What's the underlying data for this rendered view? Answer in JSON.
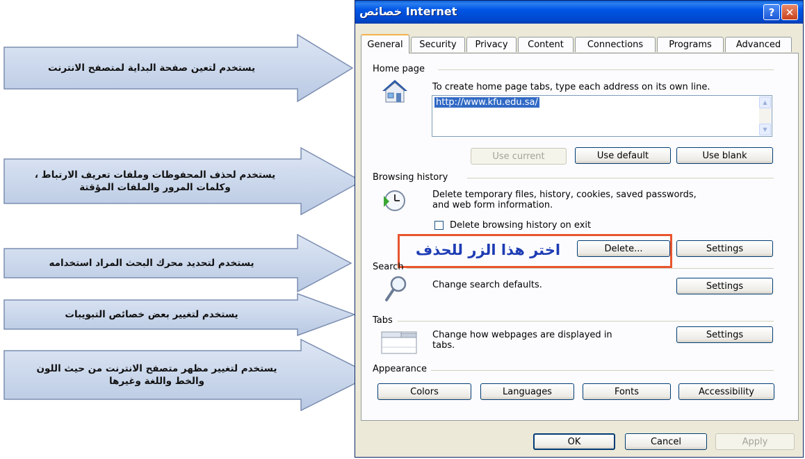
{
  "callouts": [
    {
      "text": "يستخدم لتعين صفحة البداية لمتصفح الانترنت"
    },
    {
      "line1": "يستخدم لحذف المحفوظات وملفات تعريف الارتباط ،",
      "line2": "وكلمات المرور والملفات المؤقتة"
    },
    {
      "text": "يستخدم لتحديد محرك البحث المراد استخدامه"
    },
    {
      "text": "يستخدم لتغيير بعض خصائص التبويبات"
    },
    {
      "line1": "يستخدم لتغيير مظهر متصفح الانترنت من حيث اللون",
      "line2": "والخط واللغة وغيرها"
    }
  ],
  "dialog": {
    "title": "خصائص Internet",
    "help_label": "?",
    "close_label": "✕",
    "tabs": [
      "General",
      "Security",
      "Privacy",
      "Content",
      "Connections",
      "Programs",
      "Advanced"
    ],
    "home_page": {
      "label": "Home page",
      "description": "To create home page tabs, type each address on its own line.",
      "url": "http://www.kfu.edu.sa/",
      "use_current": "Use current",
      "use_default": "Use default",
      "use_blank": "Use blank",
      "icon": "house-icon"
    },
    "browsing_history": {
      "label": "Browsing history",
      "description_line1": "Delete temporary files, history, cookies, saved passwords,",
      "description_line2": "and web form information.",
      "checkbox_label": "Delete browsing history on exit",
      "delete_label": "Delete...",
      "settings_label": "Settings",
      "icon": "history-clock-icon"
    },
    "instruction": "اختر هذا الزر للحذف",
    "search": {
      "label": "Search",
      "description": "Change search defaults.",
      "settings_label": "Settings",
      "icon": "magnifier-icon"
    },
    "tabs_section": {
      "label": "Tabs",
      "description_line1": "Change how webpages are displayed in",
      "description_line2": "tabs.",
      "settings_label": "Settings",
      "icon": "tabs-window-icon"
    },
    "appearance": {
      "label": "Appearance",
      "buttons": [
        "Colors",
        "Languages",
        "Fonts",
        "Accessibility"
      ]
    },
    "footer": {
      "ok": "OK",
      "cancel": "Cancel",
      "apply": "Apply"
    }
  },
  "colors": {
    "arrow_fill": "#c9d6ec",
    "arrow_stroke": "#7b8db0",
    "highlight": "#e8552e",
    "instruction": "#1e3cb4",
    "titlebar": "#0055e5"
  }
}
